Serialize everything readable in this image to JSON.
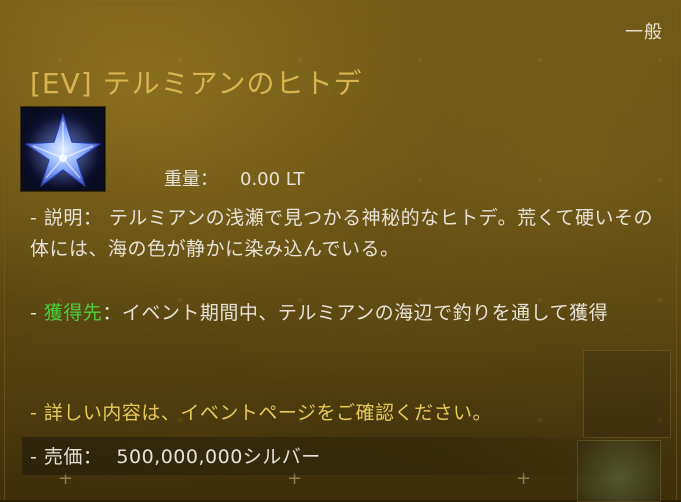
{
  "tooltip": {
    "grade": "一般",
    "title": "[EV] テルミアンのヒトデ",
    "icon": "starfish-icon",
    "weight_label": "重量：",
    "weight_value": "0.00 LT",
    "description": "- 説明： テルミアンの浅瀬で見つかる神秘的なヒトデ。荒くて硬いその体には、海の色が静かに染み込んでいる。",
    "obtain_prefix": "- ",
    "obtain_label": "獲得先",
    "obtain_text": "：イベント期間中、テルミアンの海辺で釣りを通して獲得",
    "details": "- 詳しい内容は、イベントページをご確認ください。",
    "price_label": "- 売価：",
    "price_value": "500,000,000シルバー"
  },
  "colors": {
    "title": "#d8b44e",
    "body_text": "#e6e2d6",
    "obtain_label": "#4ccf3a",
    "details": "#e7c95a"
  }
}
